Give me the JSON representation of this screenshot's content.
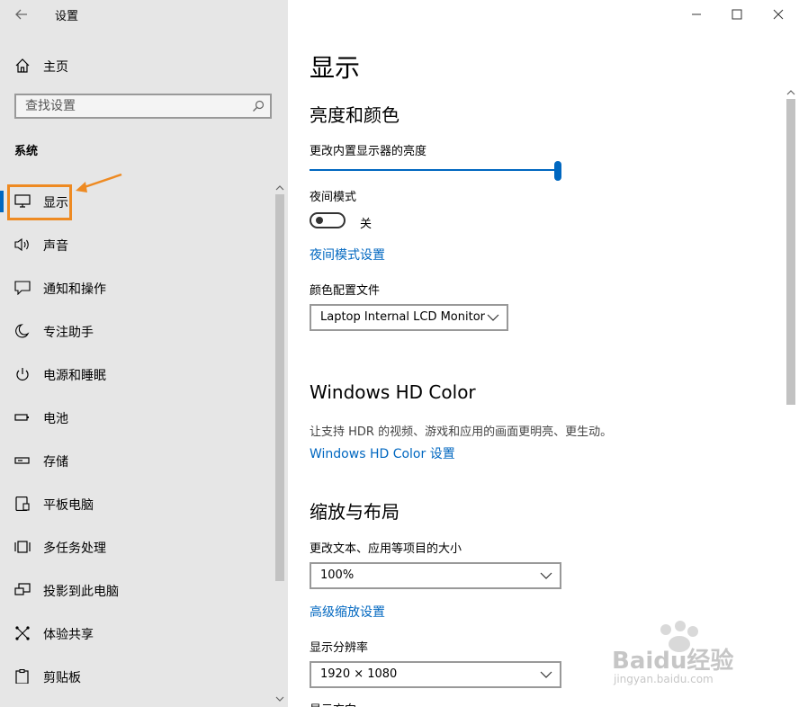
{
  "app": {
    "title": "设置"
  },
  "sidebar": {
    "home_label": "主页",
    "search": {
      "placeholder": "查找设置"
    },
    "section_header": "系统",
    "items": [
      {
        "label": "显示",
        "icon": "monitor-icon",
        "active": true
      },
      {
        "label": "声音",
        "icon": "speaker-icon"
      },
      {
        "label": "通知和操作",
        "icon": "notification-icon"
      },
      {
        "label": "专注助手",
        "icon": "moon-icon"
      },
      {
        "label": "电源和睡眠",
        "icon": "power-icon"
      },
      {
        "label": "电池",
        "icon": "battery-icon"
      },
      {
        "label": "存储",
        "icon": "storage-icon"
      },
      {
        "label": "平板电脑",
        "icon": "tablet-icon"
      },
      {
        "label": "多任务处理",
        "icon": "multitask-icon"
      },
      {
        "label": "投影到此电脑",
        "icon": "project-icon"
      },
      {
        "label": "体验共享",
        "icon": "share-icon"
      },
      {
        "label": "剪贴板",
        "icon": "clipboard-icon"
      }
    ]
  },
  "main": {
    "page_title": "显示",
    "brightness_section": {
      "title": "亮度和颜色",
      "brightness_label": "更改内置显示器的亮度",
      "brightness_value": 1.0,
      "night_mode_label": "夜间模式",
      "night_mode_state": "关",
      "night_mode_link": "夜间模式设置",
      "color_profile_label": "颜色配置文件",
      "color_profile_value": "Laptop Internal LCD Monitor"
    },
    "hdr_section": {
      "title": "Windows HD Color",
      "description": "让支持 HDR 的视频、游戏和应用的画面更明亮、更生动。",
      "link": "Windows HD Color 设置"
    },
    "scale_section": {
      "title": "缩放与布局",
      "scale_label": "更改文本、应用等项目的大小",
      "scale_value": "100%",
      "advanced_link": "高级缩放设置",
      "resolution_label": "显示分辨率",
      "resolution_value": "1920 × 1080",
      "orientation_label": "显示方向"
    }
  },
  "colors": {
    "accent": "#0067c0",
    "highlight": "#ee8a22",
    "sidebar_bg": "#e6e6e6"
  },
  "watermark": {
    "text": "Baidu经验",
    "subtext": "jingyan.baidu.com"
  }
}
